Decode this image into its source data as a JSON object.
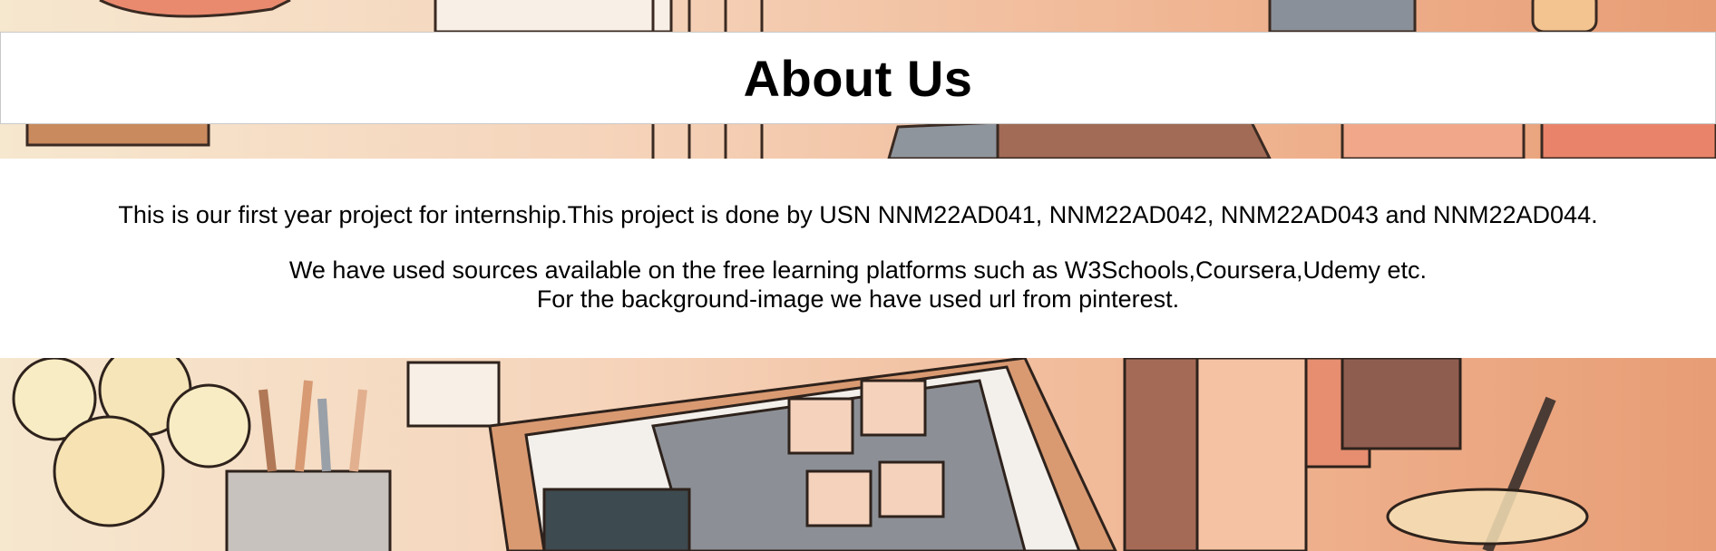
{
  "header": {
    "title": "About Us"
  },
  "content": {
    "intro": "This is our first year project for internship.This project is done by USN NNM22AD041, NNM22AD042, NNM22AD043 and NNM22AD044.",
    "sources_line1": "We have used sources available on the free learning platforms such as W3Schools,Coursera,Udemy etc.",
    "sources_line2": "For the background-image we have used url from pinterest."
  },
  "background": {
    "description_icon": "desk-illustration-image",
    "colors": {
      "peach": "#f4c9a8",
      "salmon": "#e8a07a",
      "cream": "#f6e4c8",
      "slate": "#8a9099",
      "outline": "#3a2a22"
    }
  }
}
